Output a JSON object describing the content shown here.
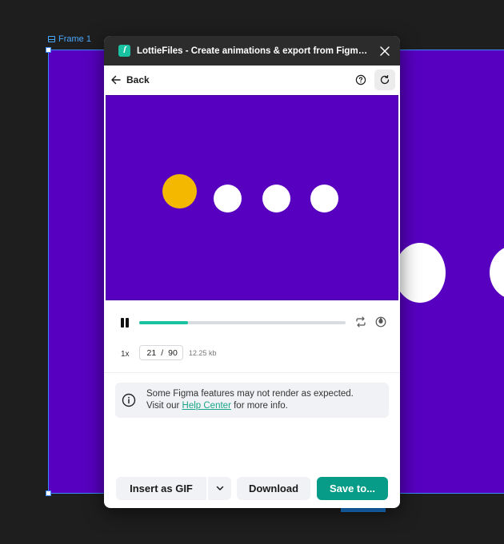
{
  "canvas": {
    "frame_label": "Frame 1",
    "frame_color": "#5700c0",
    "selection_color": "#3b8cff"
  },
  "plugin": {
    "title": "LottieFiles - Create animations & export from Figma to Lot...",
    "logo_icon": "lottiefiles-logo-icon",
    "close_icon": "close-icon",
    "brand_color": "#19c2a1",
    "toolbar": {
      "back_label": "Back",
      "back_icon": "arrow-left-icon",
      "help_icon": "help-circle-icon",
      "refresh_icon": "refresh-icon"
    },
    "player": {
      "current_frame": "21",
      "separator": "/",
      "total_frames": "90",
      "file_size": "12.25 kb",
      "speed": "1x",
      "progress": 0.235,
      "loop_icon": "loop-icon",
      "background_icon": "background-toggle-icon",
      "pause_icon": "pause-icon"
    },
    "notice": {
      "line1": "Some Figma features may not render as expected.",
      "prefix": "Visit our ",
      "link_text": "Help Center",
      "suffix": " for more info.",
      "icon": "info-icon"
    },
    "actions": {
      "insert_gif": "Insert as GIF",
      "caret_icon": "chevron-down-icon",
      "download": "Download",
      "save": "Save to..."
    }
  }
}
